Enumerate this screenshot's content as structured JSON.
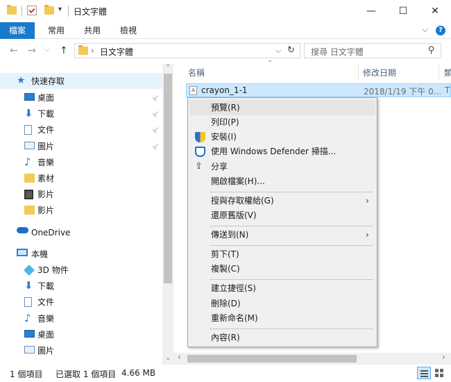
{
  "window": {
    "title": "日文字體",
    "minimize": "—",
    "maximize": "☐",
    "close": "✕"
  },
  "ribbon": {
    "tabs": [
      "檔案",
      "常用",
      "共用",
      "檢視"
    ],
    "expand": "⌵",
    "help": "?"
  },
  "address": {
    "back": "←",
    "forward": "→",
    "recent": "⌵",
    "up": "↑",
    "crumb_sep": "›",
    "path": "日文字體",
    "dropdown": "⌵",
    "refresh": "↻",
    "search_placeholder": "搜尋 日文字體",
    "search_icon": "⚲"
  },
  "nav": {
    "quick_access": "快速存取",
    "quick_items": [
      {
        "label": "桌面",
        "pinned": true,
        "icon": "desktop-icon"
      },
      {
        "label": "下載",
        "pinned": true,
        "icon": "download-icon"
      },
      {
        "label": "文件",
        "pinned": true,
        "icon": "document-icon"
      },
      {
        "label": "圖片",
        "pinned": true,
        "icon": "picture-icon"
      },
      {
        "label": "音樂",
        "pinned": false,
        "icon": "music-icon"
      },
      {
        "label": "素材",
        "pinned": false,
        "icon": "folder-icon"
      },
      {
        "label": "影片",
        "pinned": false,
        "icon": "video-icon"
      },
      {
        "label": "影片",
        "pinned": false,
        "icon": "folder-icon"
      }
    ],
    "onedrive": "OneDrive",
    "this_pc": "本機",
    "pc_items": [
      {
        "label": "3D 物件",
        "icon": "3d-objects-icon"
      },
      {
        "label": "下載",
        "icon": "download-icon"
      },
      {
        "label": "文件",
        "icon": "document-icon"
      },
      {
        "label": "音樂",
        "icon": "music-icon"
      },
      {
        "label": "桌面",
        "icon": "desktop-icon"
      },
      {
        "label": "圖片",
        "icon": "picture-icon"
      }
    ],
    "pin_glyph": "📌",
    "scroll_up": "⌃",
    "scroll_down": "⌄"
  },
  "filelist": {
    "col_name": "名稱",
    "col_date": "修改日期",
    "col_type": "類",
    "sort_arrow": "⌃",
    "file_name": "crayon_1-1",
    "file_date": "2018/1/19 下午 0...",
    "file_type": "T",
    "hscroll_left": "‹",
    "hscroll_right": "›"
  },
  "context_menu": {
    "items": [
      {
        "label": "預覽(R)"
      },
      {
        "label": "列印(P)"
      },
      {
        "label": "安裝(I)"
      },
      {
        "label": "使用 Windows Defender 掃描..."
      },
      {
        "label": "分享"
      },
      {
        "label": "開啟檔案(H)..."
      },
      {
        "label": "授與存取權給(G)"
      },
      {
        "label": "還原舊版(V)"
      },
      {
        "label": "傳送到(N)"
      },
      {
        "label": "剪下(T)"
      },
      {
        "label": "複製(C)"
      },
      {
        "label": "建立捷徑(S)"
      },
      {
        "label": "刪除(D)"
      },
      {
        "label": "重新命名(M)"
      },
      {
        "label": "內容(R)"
      }
    ],
    "submenu_arrow": "›"
  },
  "status": {
    "count": "1 個項目",
    "selected": "已選取 1 個項目",
    "size": "4.66 MB"
  },
  "colors": {
    "accent": "#1979ca",
    "selection": "#cce8ff",
    "folder": "#f3c957"
  }
}
